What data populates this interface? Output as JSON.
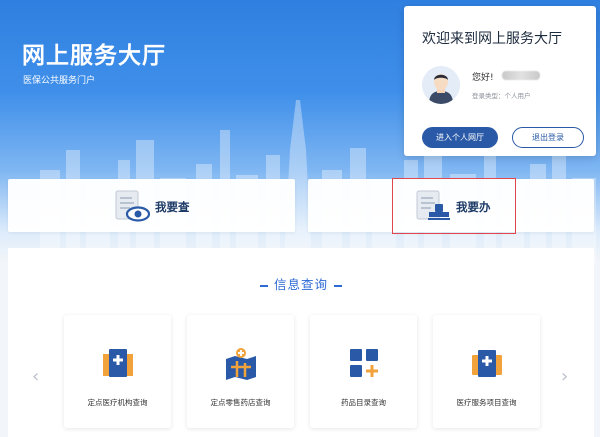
{
  "hero": {
    "title": "网上服务大厅",
    "subtitle": "医保公共服务门户"
  },
  "welcome": {
    "title": "欢迎来到网上服务大厅",
    "greeting": "您好!",
    "login_type": "登录类型：个人用户",
    "enter_button": "进入个人网厅",
    "logout_button": "退出登录"
  },
  "actions": {
    "query_label": "我要查",
    "do_label": "我要办"
  },
  "info_query": {
    "title": "信息查询",
    "tiles": [
      {
        "label": "定点医疗机构查询",
        "icon": "hospital-icon"
      },
      {
        "label": "定点零售药店查询",
        "icon": "pharmacy-map-icon"
      },
      {
        "label": "药品目录查询",
        "icon": "catalog-grid-icon"
      },
      {
        "label": "医疗服务项目查询",
        "icon": "medical-kit-icon"
      }
    ]
  },
  "colors": {
    "accent": "#2d6ad6",
    "primary_button": "#2a5aa7",
    "highlight": "#e0474c",
    "icon_orange": "#f1a23b"
  }
}
